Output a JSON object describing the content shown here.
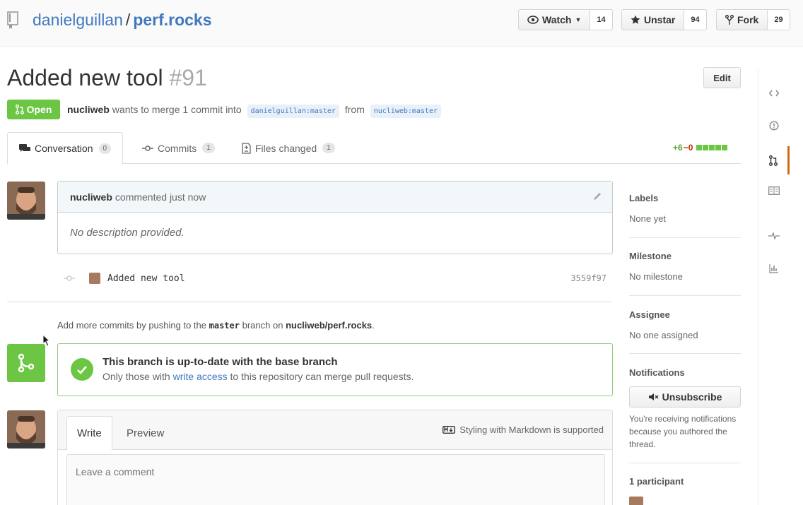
{
  "repo": {
    "owner": "danielguillan",
    "separator": "/",
    "name": "perf.rocks"
  },
  "actions": {
    "watch": {
      "label": "Watch",
      "count": "14"
    },
    "unstar": {
      "label": "Unstar",
      "count": "94"
    },
    "fork": {
      "label": "Fork",
      "count": "29"
    }
  },
  "pr": {
    "title": "Added new tool",
    "number": "#91",
    "edit_label": "Edit",
    "state": "Open",
    "author": "nucliweb",
    "meta_text": "wants to merge 1 commit into",
    "base_branch": "danielguillan:master",
    "from_text": "from",
    "head_branch": "nucliweb:master"
  },
  "tabs": [
    {
      "label": "Conversation",
      "count": "0"
    },
    {
      "label": "Commits",
      "count": "1"
    },
    {
      "label": "Files changed",
      "count": "1"
    }
  ],
  "diffstat": {
    "additions": "+6",
    "deletions": "−0"
  },
  "comment": {
    "author": "nucliweb",
    "action": "commented just now",
    "body": "No description provided."
  },
  "commit": {
    "message": "Added new tool",
    "sha": "3559f97"
  },
  "push_hint": {
    "prefix": "Add more commits by pushing to the",
    "branch": "master",
    "middle": "branch on",
    "repo": "nucliweb/perf.rocks",
    "suffix": "."
  },
  "merge": {
    "title": "This branch is up-to-date with the base branch",
    "sub_prefix": "Only those with",
    "sub_link": "write access",
    "sub_suffix": "to this repository can merge pull requests."
  },
  "new_comment": {
    "write_tab": "Write",
    "preview_tab": "Preview",
    "markdown_hint": "Styling with Markdown is supported",
    "placeholder": "Leave a comment"
  },
  "sidebar": {
    "labels": {
      "heading": "Labels",
      "value": "None yet"
    },
    "milestone": {
      "heading": "Milestone",
      "value": "No milestone"
    },
    "assignee": {
      "heading": "Assignee",
      "value": "No one assigned"
    },
    "notifications": {
      "heading": "Notifications",
      "button": "Unsubscribe",
      "text": "You're receiving notifications because you authored the thread."
    },
    "participants": {
      "heading": "1 participant"
    }
  },
  "colors": {
    "accent": "#4078c0",
    "success": "#6cc644",
    "active_nav": "#d26911"
  },
  "icons": [
    "repo-icon",
    "eye-icon",
    "star-icon",
    "fork-icon",
    "pr-icon",
    "comment-icon",
    "commit-icon",
    "file-diff-icon",
    "pencil-icon",
    "check-icon",
    "merge-icon",
    "markdown-icon",
    "mute-icon",
    "code-icon",
    "issue-icon",
    "book-icon",
    "pulse-icon",
    "graph-icon"
  ]
}
